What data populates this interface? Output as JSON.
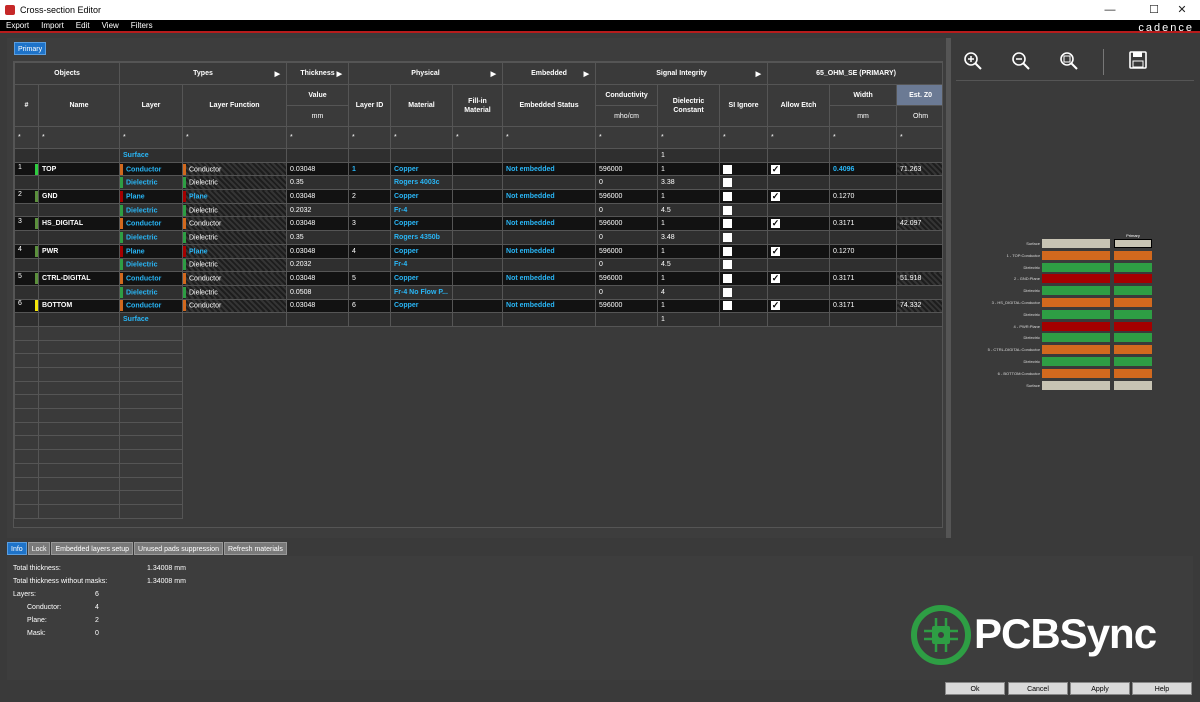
{
  "window": {
    "title": "Cross-section Editor",
    "minimize": "—",
    "maximize": "☐",
    "close": "✕"
  },
  "brand": "cadence",
  "menu": [
    "Export",
    "Import",
    "Edit",
    "View",
    "Filters"
  ],
  "primary_tab": "Primary",
  "group_headers": [
    {
      "label": "Objects",
      "arrow": ""
    },
    {
      "label": "Types",
      "arrow": "▶"
    },
    {
      "label": "Thickness",
      "arrow": "▶"
    },
    {
      "label": "Physical",
      "arrow": "▶"
    },
    {
      "label": "Embedded",
      "arrow": "▶"
    },
    {
      "label": "Signal Integrity",
      "arrow": "▶"
    },
    {
      "label": "65_OHM_SE (PRIMARY)",
      "arrow": ""
    }
  ],
  "columns": [
    "#",
    "Name",
    "Layer",
    "Layer Function",
    "Value",
    "Layer ID",
    "Material",
    "Fill-in Material",
    "Embedded Status",
    "Conductivity",
    "Dielectric Constant",
    "SI Ignore",
    "Allow Etch",
    "Width",
    "Est. Z0"
  ],
  "units": {
    "value": "mm",
    "conductivity": "mho/cm",
    "width": "mm",
    "estz0": "Ohm"
  },
  "filter_mark": "*",
  "rows": [
    {
      "kind": "surf",
      "num": "",
      "name": "",
      "layer": "Surface",
      "func": "",
      "val": "",
      "lid": "",
      "mat": "",
      "fill": "",
      "emb": "",
      "cond": "",
      "dk": "1",
      "si": false,
      "etch": false,
      "width": "",
      "z0": ""
    },
    {
      "kind": "cond",
      "num": "1",
      "name": "TOP",
      "layer": "Conductor",
      "func": "Conductor",
      "val": "0.03048",
      "lid": "1",
      "mat": "Copper",
      "fill": "",
      "emb": "Not embedded",
      "cond": "596000",
      "dk": "1",
      "si": true,
      "etch": true,
      "width": "0.4096",
      "z0": "71.263",
      "numcolor": "#2ecc40",
      "wblue": true,
      "zhatch": true
    },
    {
      "kind": "diel",
      "num": "",
      "name": "",
      "layer": "Dielectric",
      "func": "Dielectric",
      "val": "0.35",
      "lid": "",
      "mat": "Rogers 4003c",
      "fill": "",
      "emb": "",
      "cond": "0",
      "dk": "3.38",
      "si": true,
      "etch": false,
      "width": "",
      "z0": ""
    },
    {
      "kind": "plane",
      "num": "2",
      "name": "GND",
      "layer": "Plane",
      "func": "Plane",
      "val": "0.03048",
      "lid": "2",
      "mat": "Copper",
      "fill": "",
      "emb": "Not embedded",
      "cond": "596000",
      "dk": "1",
      "si": true,
      "etch": true,
      "width": "0.1270",
      "z0": "",
      "numcolor": "#5b8f3c"
    },
    {
      "kind": "diel",
      "num": "",
      "name": "",
      "layer": "Dielectric",
      "func": "Dielectric",
      "val": "0.2032",
      "lid": "",
      "mat": "Fr-4",
      "fill": "",
      "emb": "",
      "cond": "0",
      "dk": "4.5",
      "si": true,
      "etch": false,
      "width": "",
      "z0": ""
    },
    {
      "kind": "cond",
      "num": "3",
      "name": "HS_DIGITAL",
      "layer": "Conductor",
      "func": "Conductor",
      "val": "0.03048",
      "lid": "3",
      "mat": "Copper",
      "fill": "",
      "emb": "Not embedded",
      "cond": "596000",
      "dk": "1",
      "si": true,
      "etch": true,
      "width": "0.3171",
      "z0": "42.097",
      "numcolor": "#5b8f3c",
      "zhatch": true
    },
    {
      "kind": "diel",
      "num": "",
      "name": "",
      "layer": "Dielectric",
      "func": "Dielectric",
      "val": "0.35",
      "lid": "",
      "mat": "Rogers 4350b",
      "fill": "",
      "emb": "",
      "cond": "0",
      "dk": "3.48",
      "si": true,
      "etch": false,
      "width": "",
      "z0": ""
    },
    {
      "kind": "plane",
      "num": "4",
      "name": "PWR",
      "layer": "Plane",
      "func": "Plane",
      "val": "0.03048",
      "lid": "4",
      "mat": "Copper",
      "fill": "",
      "emb": "Not embedded",
      "cond": "596000",
      "dk": "1",
      "si": true,
      "etch": true,
      "width": "0.1270",
      "z0": "",
      "numcolor": "#5b8f3c"
    },
    {
      "kind": "diel",
      "num": "",
      "name": "",
      "layer": "Dielectric",
      "func": "Dielectric",
      "val": "0.2032",
      "lid": "",
      "mat": "Fr-4",
      "fill": "",
      "emb": "",
      "cond": "0",
      "dk": "4.5",
      "si": true,
      "etch": false,
      "width": "",
      "z0": ""
    },
    {
      "kind": "cond",
      "num": "5",
      "name": "CTRL-DIGITAL",
      "layer": "Conductor",
      "func": "Conductor",
      "val": "0.03048",
      "lid": "5",
      "mat": "Copper",
      "fill": "",
      "emb": "Not embedded",
      "cond": "596000",
      "dk": "1",
      "si": true,
      "etch": true,
      "width": "0.3171",
      "z0": "51.918",
      "numcolor": "#5b8f3c",
      "zhatch": true
    },
    {
      "kind": "diel",
      "num": "",
      "name": "",
      "layer": "Dielectric",
      "func": "Dielectric",
      "val": "0.0508",
      "lid": "",
      "mat": "Fr-4 No Flow P...",
      "fill": "",
      "emb": "",
      "cond": "0",
      "dk": "4",
      "si": true,
      "etch": false,
      "width": "",
      "z0": ""
    },
    {
      "kind": "cond",
      "num": "6",
      "name": "BOTTOM",
      "layer": "Conductor",
      "func": "Conductor",
      "val": "0.03048",
      "lid": "6",
      "mat": "Copper",
      "fill": "",
      "emb": "Not embedded",
      "cond": "596000",
      "dk": "1",
      "si": true,
      "etch": true,
      "width": "0.3171",
      "z0": "74.332",
      "numcolor": "#f5e50a",
      "zhatch": true
    },
    {
      "kind": "surf",
      "num": "",
      "name": "",
      "layer": "Surface",
      "func": "",
      "val": "",
      "lid": "",
      "mat": "",
      "fill": "",
      "emb": "",
      "cond": "",
      "dk": "1",
      "si": false,
      "etch": false,
      "width": "",
      "z0": ""
    }
  ],
  "colors": {
    "conductor": "#d2691e",
    "dielectric": "#2e9e44",
    "plane": "#a50000",
    "surface": "#c8c4b4",
    "accent": "#1e73c9"
  },
  "toolbar": [
    "zoom-in-icon",
    "zoom-out-icon",
    "zoom-fit-icon",
    "save-icon"
  ],
  "stackup_header": "Primary",
  "stackup": [
    {
      "label": "Surface",
      "kind": "surf"
    },
    {
      "label": "1 - TOP:Conductor",
      "kind": "cond"
    },
    {
      "label": "Dielectric",
      "kind": "diel"
    },
    {
      "label": "2 - GND:Plane",
      "kind": "plane"
    },
    {
      "label": "Dielectric",
      "kind": "diel"
    },
    {
      "label": "3 - HS_DIGITAL:Conductor",
      "kind": "cond"
    },
    {
      "label": "Dielectric",
      "kind": "diel"
    },
    {
      "label": "4 - PWR:Plane",
      "kind": "plane"
    },
    {
      "label": "Dielectric",
      "kind": "diel"
    },
    {
      "label": "5 - CTRL-DIGITAL:Conductor",
      "kind": "cond"
    },
    {
      "label": "Dielectric",
      "kind": "diel"
    },
    {
      "label": "6 - BOTTOM:Conductor",
      "kind": "cond"
    },
    {
      "label": "Surface",
      "kind": "surf"
    }
  ],
  "bottom_tabs": [
    "Info",
    "Lock",
    "Embedded layers setup",
    "Unused pads suppression",
    "Refresh materials"
  ],
  "info": {
    "total_thickness_label": "Total thickness:",
    "total_thickness": "1.34008 mm",
    "total_nomask_label": "Total thickness without masks:",
    "total_nomask": "1.34008 mm",
    "layers_label": "Layers:",
    "layers": "6",
    "conductor_label": "Conductor:",
    "conductor": "4",
    "plane_label": "Plane:",
    "plane": "2",
    "mask_label": "Mask:",
    "mask": "0"
  },
  "logo_text": "PCBSync",
  "buttons": [
    "Ok",
    "Cancel",
    "Apply",
    "Help"
  ]
}
